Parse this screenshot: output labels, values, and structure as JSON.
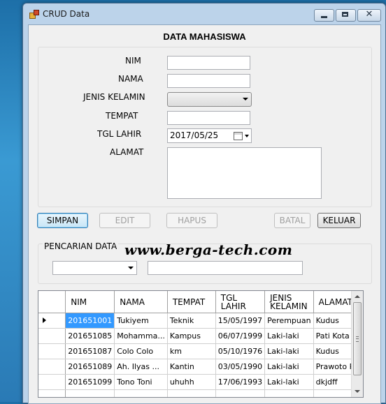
{
  "window": {
    "title": "CRUD Data"
  },
  "form": {
    "heading": "DATA MAHASISWA",
    "labels": {
      "nim": "NIM",
      "nama": "NAMA",
      "jenis_kelamin": "JENIS KELAMIN",
      "tempat": "TEMPAT",
      "tgl_lahir": "TGL LAHIR",
      "alamat": "ALAMAT"
    },
    "values": {
      "nim": "",
      "nama": "",
      "jenis_kelamin": "",
      "tempat": "",
      "tgl_lahir": "2017/05/25",
      "alamat": ""
    }
  },
  "buttons": {
    "simpan": "SIMPAN",
    "edit": "EDIT",
    "hapus": "HAPUS",
    "batal": "BATAL",
    "keluar": "KELUAR"
  },
  "search": {
    "group_label": "PENCARIAN DATA",
    "combo_value": "",
    "text_value": ""
  },
  "watermark": "www.berga-tech.com",
  "grid": {
    "columns": [
      "NIM",
      "NAMA",
      "TEMPAT",
      "TGL LAHIR",
      "JENIS KELAMIN",
      "ALAMAT"
    ],
    "rows": [
      [
        "201651001",
        "Tukiyem",
        "Teknik",
        "15/05/1997",
        "Perempuan",
        "Kudus"
      ],
      [
        "201651085",
        "Mohamma...",
        "Kampus",
        "06/07/1999",
        "Laki-laki",
        "Pati Kota"
      ],
      [
        "201651087",
        "Colo Colo",
        "km",
        "05/10/1976",
        "Laki-laki",
        "Kudus"
      ],
      [
        "201651089",
        "Ah. Ilyas ...",
        "Kantin",
        "03/05/1990",
        "Laki-laki",
        "Prawoto P..."
      ],
      [
        "201651099",
        "Tono Toni",
        "uhuhh",
        "17/06/1993",
        "Laki-laki",
        "dkjdff"
      ]
    ]
  },
  "colors": {
    "selection": "#3399ff",
    "window_frame": "#bcd3ea",
    "desktop": "#2a7ab5"
  }
}
